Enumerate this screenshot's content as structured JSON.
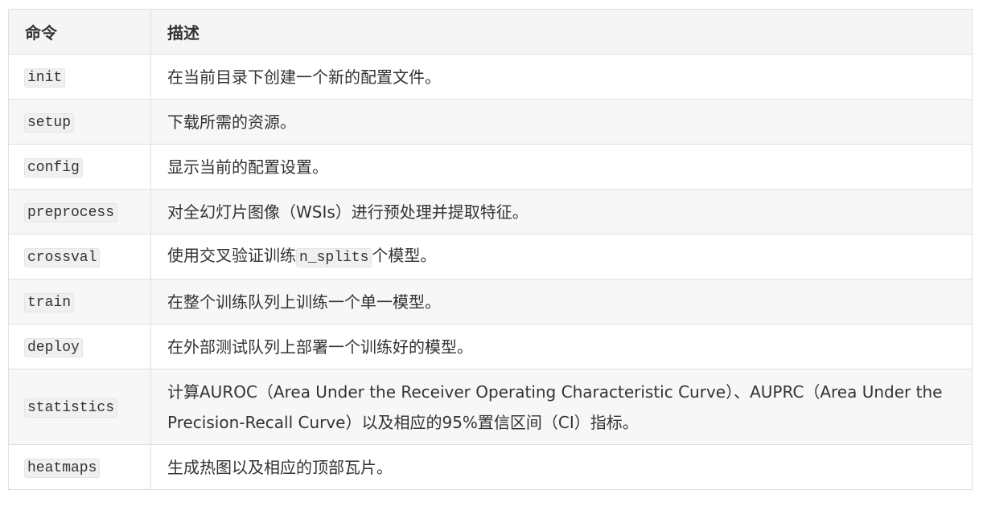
{
  "table": {
    "headers": [
      "命令",
      "描述"
    ],
    "rows": [
      {
        "command": "init",
        "desc_before": "在当前目录下创建一个新的配置文件。",
        "desc_code": "",
        "desc_after": ""
      },
      {
        "command": "setup",
        "desc_before": "下载所需的资源。",
        "desc_code": "",
        "desc_after": ""
      },
      {
        "command": "config",
        "desc_before": "显示当前的配置设置。",
        "desc_code": "",
        "desc_after": ""
      },
      {
        "command": "preprocess",
        "desc_before": "对全幻灯片图像（WSIs）进行预处理并提取特征。",
        "desc_code": "",
        "desc_after": ""
      },
      {
        "command": "crossval",
        "desc_before": "使用交叉验证训练",
        "desc_code": "n_splits",
        "desc_after": "个模型。"
      },
      {
        "command": "train",
        "desc_before": "在整个训练队列上训练一个单一模型。",
        "desc_code": "",
        "desc_after": ""
      },
      {
        "command": "deploy",
        "desc_before": "在外部测试队列上部署一个训练好的模型。",
        "desc_code": "",
        "desc_after": ""
      },
      {
        "command": "statistics",
        "desc_before": "计算AUROC（Area Under the Receiver Operating Characteristic Curve）、AUPRC（Area Under the Precision-Recall Curve）以及相应的95%置信区间（CI）指标。",
        "desc_code": "",
        "desc_after": ""
      },
      {
        "command": "heatmaps",
        "desc_before": "生成热图以及相应的顶部瓦片。",
        "desc_code": "",
        "desc_after": ""
      }
    ]
  }
}
